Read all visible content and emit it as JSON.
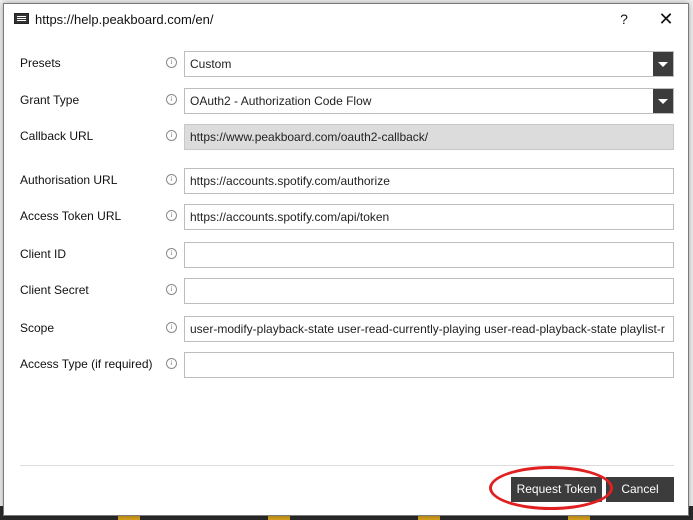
{
  "window": {
    "title": "https://help.peakboard.com/en/",
    "help_label": "?",
    "close_label": "✕"
  },
  "form": {
    "fields": [
      {
        "label": "Presets",
        "value": "Custom",
        "kind": "select"
      },
      {
        "label": "Grant Type",
        "value": "OAuth2 - Authorization Code Flow",
        "kind": "select"
      },
      {
        "label": "Callback URL",
        "value": "https://www.peakboard.com/oauth2-callback/",
        "kind": "readonly"
      },
      {
        "label": "Authorisation URL",
        "value": "https://accounts.spotify.com/authorize",
        "kind": "text"
      },
      {
        "label": "Access Token URL",
        "value": "https://accounts.spotify.com/api/token",
        "kind": "text"
      },
      {
        "label": "Client ID",
        "value": "",
        "kind": "masked"
      },
      {
        "label": "Client Secret",
        "value": "",
        "kind": "masked"
      },
      {
        "label": "Scope",
        "value": "user-modify-playback-state user-read-currently-playing user-read-playback-state playlist-r",
        "kind": "text"
      },
      {
        "label": "Access Type (if required)",
        "value": "",
        "kind": "text"
      }
    ],
    "info_icon": "info-icon"
  },
  "buttons": {
    "request_token": "Request Token",
    "cancel": "Cancel"
  },
  "colors": {
    "button_bg": "#3c3c3c",
    "highlight": "#e02020",
    "readonly_bg": "#dcdcdc"
  }
}
